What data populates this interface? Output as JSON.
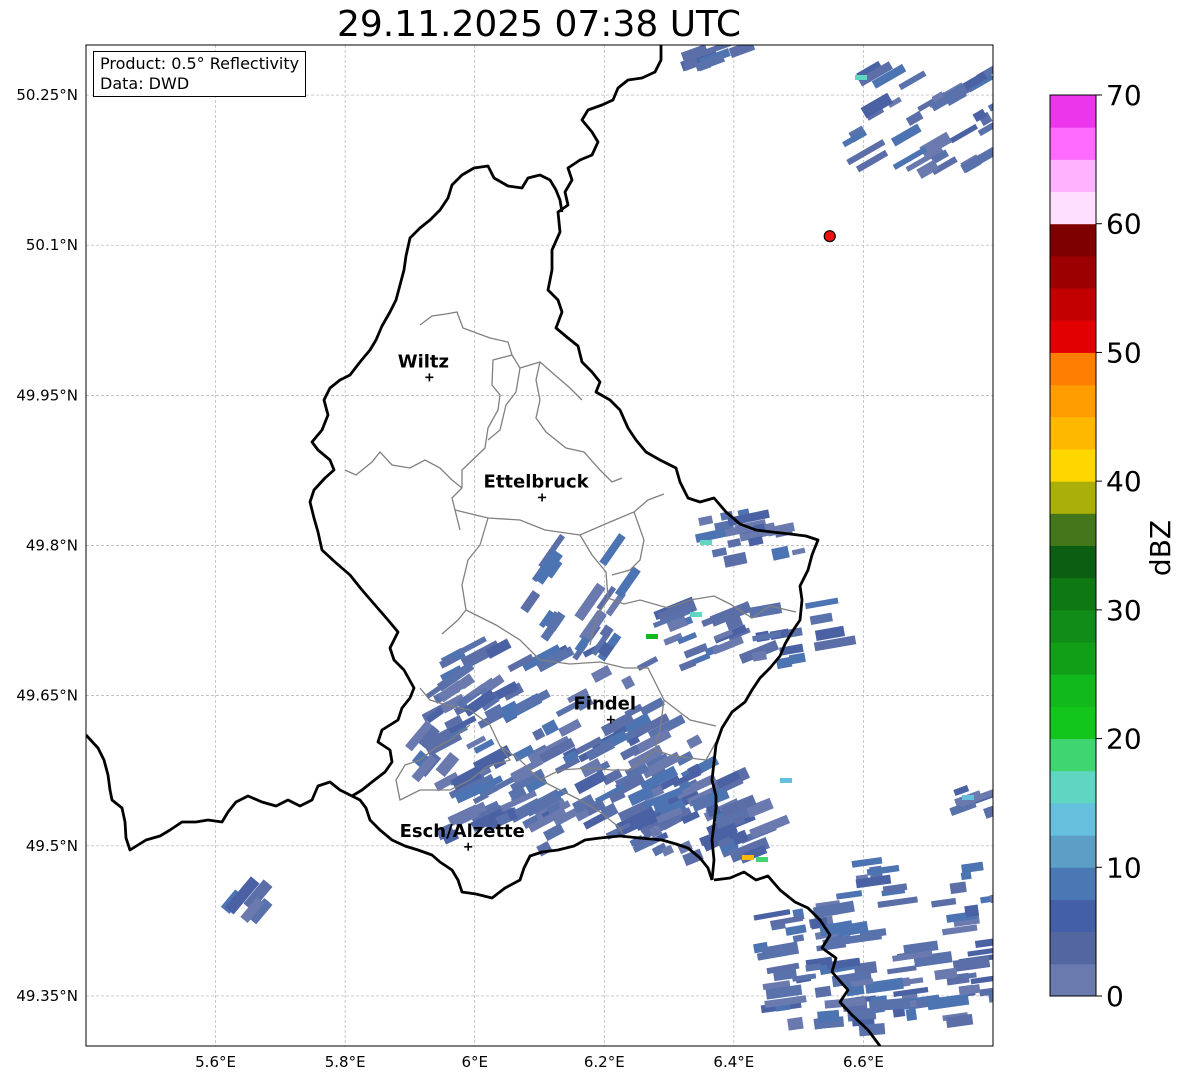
{
  "title": "29.11.2025 07:38 UTC",
  "info": {
    "product": "Product: 0.5° Reflectivity",
    "data": "Data: DWD"
  },
  "map": {
    "lon_range": [
      5.4,
      6.8
    ],
    "lat_range": [
      49.3,
      50.3
    ],
    "lon_ticks": [
      {
        "value": 5.6,
        "label": "5.6°E"
      },
      {
        "value": 5.8,
        "label": "5.8°E"
      },
      {
        "value": 6.0,
        "label": "6°E"
      },
      {
        "value": 6.2,
        "label": "6.2°E"
      },
      {
        "value": 6.4,
        "label": "6.4°E"
      },
      {
        "value": 6.6,
        "label": "6.6°E"
      }
    ],
    "lat_ticks": [
      {
        "value": 50.25,
        "label": "50.25°N"
      },
      {
        "value": 50.1,
        "label": "50.1°N"
      },
      {
        "value": 49.95,
        "label": "49.95°N"
      },
      {
        "value": 49.8,
        "label": "49.8°N"
      },
      {
        "value": 49.65,
        "label": "49.65°N"
      },
      {
        "value": 49.5,
        "label": "49.5°N"
      },
      {
        "value": 49.35,
        "label": "49.35°N"
      }
    ],
    "cities": [
      {
        "name": "Wiltz",
        "lon": 5.93,
        "lat": 49.968
      },
      {
        "name": "Ettelbruck",
        "lon": 6.104,
        "lat": 49.848
      },
      {
        "name": "Findel",
        "lon": 6.21,
        "lat": 49.626
      },
      {
        "name": "Esch/Alzette",
        "lon": 5.99,
        "lat": 49.499
      }
    ],
    "radar_site": {
      "lon": 6.548,
      "lat": 50.109,
      "color": "#ee1111"
    }
  },
  "colorbar": {
    "label": "dBZ",
    "min": 0,
    "max": 70,
    "tick_labels": [
      "0",
      "10",
      "20",
      "30",
      "40",
      "50",
      "60",
      "70"
    ],
    "colors": [
      "#6a7aaf",
      "#5466a0",
      "#435fa7",
      "#4a78b4",
      "#5c9ec6",
      "#64c0dc",
      "#5fd6c2",
      "#3fd672",
      "#12c61c",
      "#12b91c",
      "#129f18",
      "#128c18",
      "#0e7812",
      "#0c5f12",
      "#44771a",
      "#abb008",
      "#ffd700",
      "#ffb800",
      "#ff9c00",
      "#ff7d00",
      "#e30000",
      "#c20000",
      "#9d0000",
      "#7e0000",
      "#ffdfff",
      "#ffb3ff",
      "#ff6bff",
      "#ec36ec"
    ]
  }
}
